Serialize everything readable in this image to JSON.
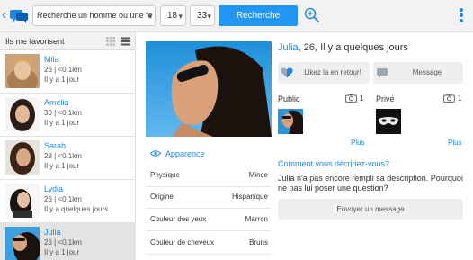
{
  "topbar": {
    "search_value": "Recherche un homme ou une fe",
    "age_min": "18",
    "age_max": "33",
    "search_button": "Recherche"
  },
  "favorites": {
    "title": "Ils me favorisent",
    "items": [
      {
        "name": "Mila",
        "details": "26 | <0.1km",
        "activity": "Il y a 1 jour"
      },
      {
        "name": "Amelia",
        "details": "30 | <0.1km",
        "activity": "Il y a 1 jour"
      },
      {
        "name": "Sarah",
        "details": "28 | <0.1km",
        "activity": "Il y a 1 jour"
      },
      {
        "name": "Lydia",
        "details": "26 | <0.1km",
        "activity": "Il y a quelques jours"
      },
      {
        "name": "Julia",
        "details": "26 | <0.1km",
        "activity": "Il y a 1 jour"
      }
    ]
  },
  "profile": {
    "name": "Julia",
    "header_rest": ", 26, Il y a quelques jours",
    "like_back": "Likez la en retour!",
    "message": "Message",
    "public_label": "Public",
    "public_count": "1",
    "private_label": "Privé",
    "private_count": "1",
    "more_public": "Plus",
    "more_private": "Plus",
    "appearance": "Apparence",
    "attributes": [
      {
        "key": "Physique",
        "value": "Mince"
      },
      {
        "key": "Origine",
        "value": "Hispanique"
      },
      {
        "key": "Couleur des yeux",
        "value": "Marron"
      },
      {
        "key": "Couleur de cheveux",
        "value": "Bruns"
      }
    ],
    "question": "Comment vous décririez-vous?",
    "description": "Julia n'a pas encore rempli sa description. Pourquoi ne pas lui poser une question?",
    "send_message": "Envoyer un message"
  },
  "colors": {
    "accent": "#1e88e5",
    "button": "#2196f3",
    "like_heart": "#1e88e5"
  },
  "icons": [
    "back-icon",
    "chat-logo-icon",
    "advanced-search-icon",
    "overflow-menu-icon",
    "grid-view-icon",
    "list-view-icon",
    "eye-icon",
    "heart-icon",
    "message-icon",
    "camera-icon",
    "mask-icon"
  ]
}
